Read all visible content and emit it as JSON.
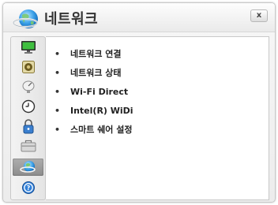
{
  "window": {
    "title": "네트워크",
    "close_label": "x"
  },
  "sidebar": {
    "items": [
      {
        "icon": "monitor-icon",
        "selected": false
      },
      {
        "icon": "speaker-icon",
        "selected": false
      },
      {
        "icon": "satellite-dish-icon",
        "selected": false
      },
      {
        "icon": "clock-icon",
        "selected": false
      },
      {
        "icon": "lock-icon",
        "selected": false
      },
      {
        "icon": "toolbox-icon",
        "selected": false
      },
      {
        "icon": "network-globe-icon",
        "selected": true
      },
      {
        "icon": "help-icon",
        "selected": false
      }
    ]
  },
  "menu": {
    "bullet": "•",
    "items": [
      {
        "label": "네트워크 연결"
      },
      {
        "label": "네트워크 상태"
      },
      {
        "label": "Wi-Fi Direct"
      },
      {
        "label": "Intel(R) WiDi"
      },
      {
        "label": "스마트 쉐어 설정"
      }
    ]
  },
  "colors": {
    "selected_bg": "#9a9a9a",
    "text": "#222222",
    "accent_blue": "#1e73c8"
  }
}
